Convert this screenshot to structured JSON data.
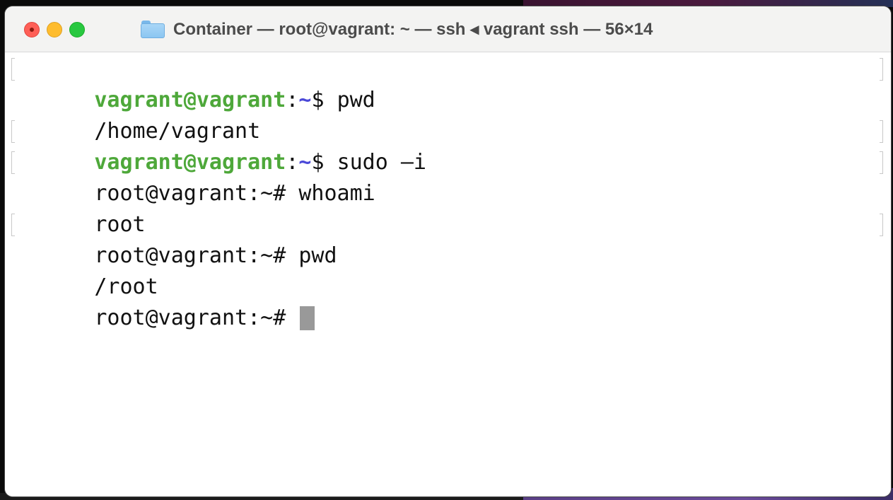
{
  "window": {
    "title": "Container — root@vagrant: ~ — ssh ◂ vagrant ssh — 56×14"
  },
  "terminal": {
    "lines": [
      {
        "user": "vagrant@vagrant",
        "sep": ":",
        "path": "~",
        "prompt": "$ ",
        "text": "pwd"
      },
      {
        "text": "/home/vagrant"
      },
      {
        "user": "vagrant@vagrant",
        "sep": ":",
        "path": "~",
        "prompt": "$ ",
        "text": "sudo –i"
      },
      {
        "text": "root@vagrant:~# whoami"
      },
      {
        "text": "root"
      },
      {
        "text": "root@vagrant:~# pwd"
      },
      {
        "text": "/root"
      },
      {
        "text": "root@vagrant:~# "
      }
    ]
  },
  "colors": {
    "user": "#4ea83a",
    "path": "#4a48d8",
    "cursor": "#999999",
    "close": "#fe5f57",
    "minimize": "#febc2e",
    "maximize": "#28c840"
  },
  "icons": {
    "title_icon": "folder-icon",
    "close": "close-icon",
    "minimize": "minimize-icon",
    "maximize": "maximize-icon"
  }
}
